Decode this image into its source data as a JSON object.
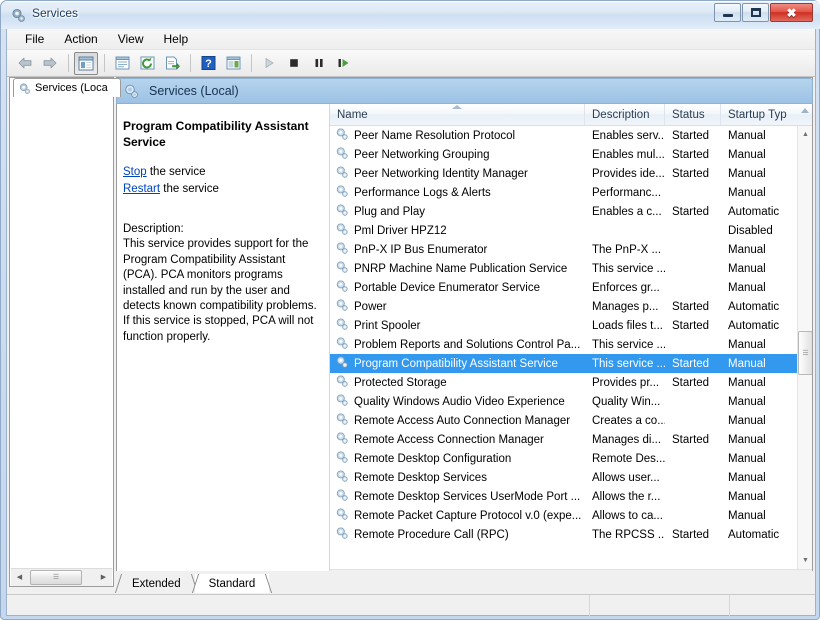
{
  "window": {
    "title": "Services",
    "icon": "services-gear-icon",
    "buttons": {
      "minimize": "Minimize",
      "maximize": "Maximize",
      "close": "Close"
    }
  },
  "menu": {
    "items": [
      {
        "label": "File",
        "name": "menu-file"
      },
      {
        "label": "Action",
        "name": "menu-action"
      },
      {
        "label": "View",
        "name": "menu-view"
      },
      {
        "label": "Help",
        "name": "menu-help"
      }
    ]
  },
  "toolbar": {
    "buttons": [
      {
        "name": "back-button",
        "icon": "back-arrow-icon",
        "title": "Back"
      },
      {
        "name": "forward-button",
        "icon": "forward-arrow-icon",
        "title": "Forward"
      },
      {
        "name": "show-hide-console-tree-button",
        "icon": "console-tree-icon",
        "title": "Show/Hide Console Tree"
      },
      {
        "name": "properties-button",
        "icon": "properties-icon",
        "title": "Properties"
      },
      {
        "name": "refresh-button",
        "icon": "refresh-icon",
        "title": "Refresh"
      },
      {
        "name": "export-list-button",
        "icon": "export-list-icon",
        "title": "Export List"
      },
      {
        "name": "help-button",
        "icon": "help-question-icon",
        "title": "Help"
      },
      {
        "name": "show-action-pane-button",
        "icon": "action-pane-icon",
        "title": "Show/Hide Action Pane"
      },
      {
        "name": "start-service-button",
        "icon": "play-icon",
        "title": "Start Service"
      },
      {
        "name": "stop-service-button",
        "icon": "stop-icon",
        "title": "Stop Service"
      },
      {
        "name": "pause-service-button",
        "icon": "pause-icon",
        "title": "Pause Service"
      },
      {
        "name": "restart-service-button",
        "icon": "restart-icon",
        "title": "Restart Service"
      }
    ]
  },
  "tree": {
    "tab_label": "Services (Loca",
    "tab_icon": "services-gear-icon"
  },
  "right_tab": {
    "label": "Services (Local)",
    "icon": "services-gear-icon"
  },
  "details": {
    "service_title": "Program Compatibility Assistant Service",
    "actions": [
      {
        "link": "Stop",
        "rest": " the service",
        "name": "stop-service-link"
      },
      {
        "link": "Restart",
        "rest": " the service",
        "name": "restart-service-link"
      }
    ],
    "description_label": "Description:",
    "description_text": "This service provides support for the Program Compatibility Assistant (PCA).  PCA monitors programs installed and run by the user and detects known compatibility problems. If this service is stopped, PCA will not function properly."
  },
  "list": {
    "columns": [
      {
        "label": "Name",
        "name": "column-header-name",
        "sorted": "asc"
      },
      {
        "label": "Description",
        "name": "column-header-description"
      },
      {
        "label": "Status",
        "name": "column-header-status"
      },
      {
        "label": "Startup Typ",
        "name": "column-header-startup-type"
      }
    ],
    "rows": [
      {
        "name": "Peer Name Resolution Protocol",
        "description": "Enables serv...",
        "status": "Started",
        "startup": "Manual",
        "selected": false
      },
      {
        "name": "Peer Networking Grouping",
        "description": "Enables mul...",
        "status": "Started",
        "startup": "Manual",
        "selected": false
      },
      {
        "name": "Peer Networking Identity Manager",
        "description": "Provides ide...",
        "status": "Started",
        "startup": "Manual",
        "selected": false
      },
      {
        "name": "Performance Logs & Alerts",
        "description": "Performanc...",
        "status": "",
        "startup": "Manual",
        "selected": false
      },
      {
        "name": "Plug and Play",
        "description": "Enables a c...",
        "status": "Started",
        "startup": "Automatic",
        "selected": false
      },
      {
        "name": "Pml Driver HPZ12",
        "description": "",
        "status": "",
        "startup": "Disabled",
        "selected": false
      },
      {
        "name": "PnP-X IP Bus Enumerator",
        "description": "The PnP-X ...",
        "status": "",
        "startup": "Manual",
        "selected": false
      },
      {
        "name": "PNRP Machine Name Publication Service",
        "description": "This service ...",
        "status": "",
        "startup": "Manual",
        "selected": false
      },
      {
        "name": "Portable Device Enumerator Service",
        "description": "Enforces gr...",
        "status": "",
        "startup": "Manual",
        "selected": false
      },
      {
        "name": "Power",
        "description": "Manages p...",
        "status": "Started",
        "startup": "Automatic",
        "selected": false
      },
      {
        "name": "Print Spooler",
        "description": "Loads files t...",
        "status": "Started",
        "startup": "Automatic",
        "selected": false
      },
      {
        "name": "Problem Reports and Solutions Control Pa...",
        "description": "This service ...",
        "status": "",
        "startup": "Manual",
        "selected": false
      },
      {
        "name": "Program Compatibility Assistant Service",
        "description": "This service ...",
        "status": "Started",
        "startup": "Manual",
        "selected": true
      },
      {
        "name": "Protected Storage",
        "description": "Provides pr...",
        "status": "Started",
        "startup": "Manual",
        "selected": false
      },
      {
        "name": "Quality Windows Audio Video Experience",
        "description": "Quality Win...",
        "status": "",
        "startup": "Manual",
        "selected": false
      },
      {
        "name": "Remote Access Auto Connection Manager",
        "description": "Creates a co...",
        "status": "",
        "startup": "Manual",
        "selected": false
      },
      {
        "name": "Remote Access Connection Manager",
        "description": "Manages di...",
        "status": "Started",
        "startup": "Manual",
        "selected": false
      },
      {
        "name": "Remote Desktop Configuration",
        "description": "Remote Des...",
        "status": "",
        "startup": "Manual",
        "selected": false
      },
      {
        "name": "Remote Desktop Services",
        "description": "Allows user...",
        "status": "",
        "startup": "Manual",
        "selected": false
      },
      {
        "name": "Remote Desktop Services UserMode Port ...",
        "description": "Allows the r...",
        "status": "",
        "startup": "Manual",
        "selected": false
      },
      {
        "name": "Remote Packet Capture Protocol v.0 (expe...",
        "description": "Allows to ca...",
        "status": "",
        "startup": "Manual",
        "selected": false
      },
      {
        "name": "Remote Procedure Call (RPC)",
        "description": "The RPCSS ...",
        "status": "Started",
        "startup": "Automatic",
        "selected": false
      }
    ]
  },
  "bottom_tabs": [
    {
      "label": "Extended",
      "name": "tab-extended",
      "active": false
    },
    {
      "label": "Standard",
      "name": "tab-standard",
      "active": true
    }
  ],
  "statusbar": {
    "section1": "",
    "section2": "",
    "section3": ""
  },
  "colors": {
    "selection": "#3399ee",
    "link": "#0044bb",
    "tab_header": "#a9cbe9",
    "close_button": "#cf2f22"
  }
}
